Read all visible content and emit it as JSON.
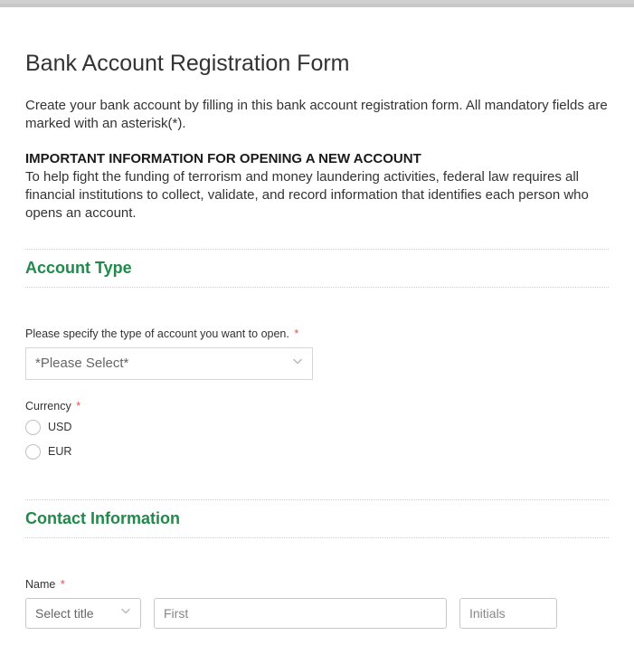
{
  "form": {
    "title": "Bank Account Registration Form",
    "description": "Create your bank account by filling in this bank account registration form. All mandatory fields are marked with an asterisk(*).",
    "important_heading": "IMPORTANT INFORMATION FOR OPENING A NEW ACCOUNT",
    "important_text": "To help fight the funding of terrorism and money laundering activities, federal law requires all financial institutions to collect, validate, and record information that identifies each person who opens an account."
  },
  "sections": {
    "account_type": {
      "title": "Account Type",
      "type_label": "Please specify the type of account you want to open.",
      "type_placeholder": "*Please Select*",
      "currency_label": "Currency",
      "currency_options": {
        "usd": "USD",
        "eur": "EUR"
      }
    },
    "contact": {
      "title": "Contact Information",
      "name_label": "Name",
      "title_placeholder": "Select title",
      "first_placeholder": "First",
      "initials_placeholder": "Initials"
    }
  },
  "asterisk": "*"
}
